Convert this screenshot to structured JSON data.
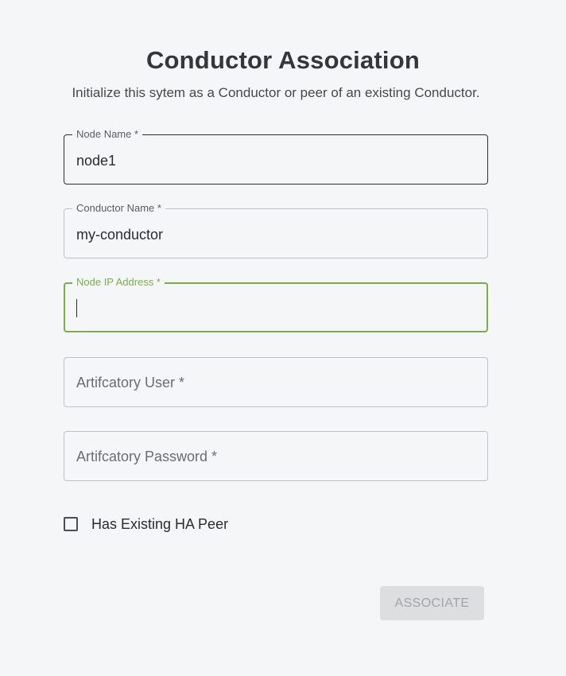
{
  "header": {
    "title": "Conductor Association",
    "subtitle": "Initialize this sytem as a Conductor or peer of an existing Conductor."
  },
  "form": {
    "node_name": {
      "label": "Node Name *",
      "value": "node1"
    },
    "conductor_name": {
      "label": "Conductor Name *",
      "value": "my-conductor"
    },
    "node_ip": {
      "label": "Node IP Address *",
      "value": ""
    },
    "artifactory_user": {
      "label": "Artifcatory User *",
      "value": ""
    },
    "artifactory_password": {
      "label": "Artifcatory Password *",
      "value": ""
    },
    "ha_peer": {
      "label": "Has Existing HA Peer",
      "checked": false
    }
  },
  "actions": {
    "associate_label": "ASSOCIATE",
    "associate_disabled": true
  },
  "colors": {
    "focus_accent": "#7dad4b",
    "background": "#f5f6f8",
    "disabled_button": "#dddee0"
  }
}
